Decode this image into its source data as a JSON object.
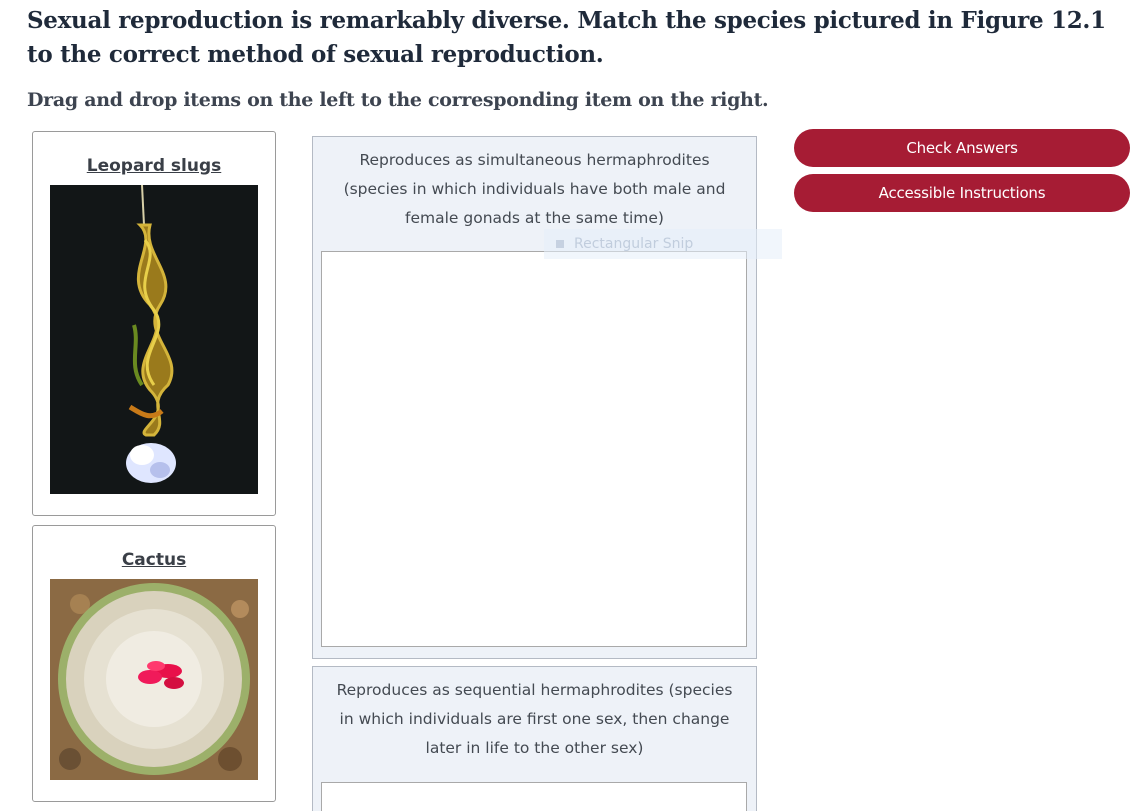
{
  "question": "Sexual reproduction is remarkably diverse. Match the species pictured in Figure 12.1 to the correct method of sexual reproduction.",
  "instructions": "Drag and drop items on the left to the corresponding item on the right.",
  "draggables": [
    {
      "title": "Leopard slugs",
      "image": "leopard-slugs-photo"
    },
    {
      "title": "Cactus",
      "image": "cactus-photo"
    }
  ],
  "targets": [
    {
      "label": "Reproduces as simultaneous hermaphrodites (species in which individuals have both male and female gonads at the same time)"
    },
    {
      "label": "Reproduces as sequential hermaphrodites (species in which individuals are first one sex, then change later in life to the other sex)"
    }
  ],
  "ghost_tooltip": "Rectangular Snip",
  "buttons": {
    "check": "Check Answers",
    "accessible": "Accessible Instructions"
  },
  "colors": {
    "button": "#a61c34",
    "zone_bg": "#eef2f8"
  }
}
